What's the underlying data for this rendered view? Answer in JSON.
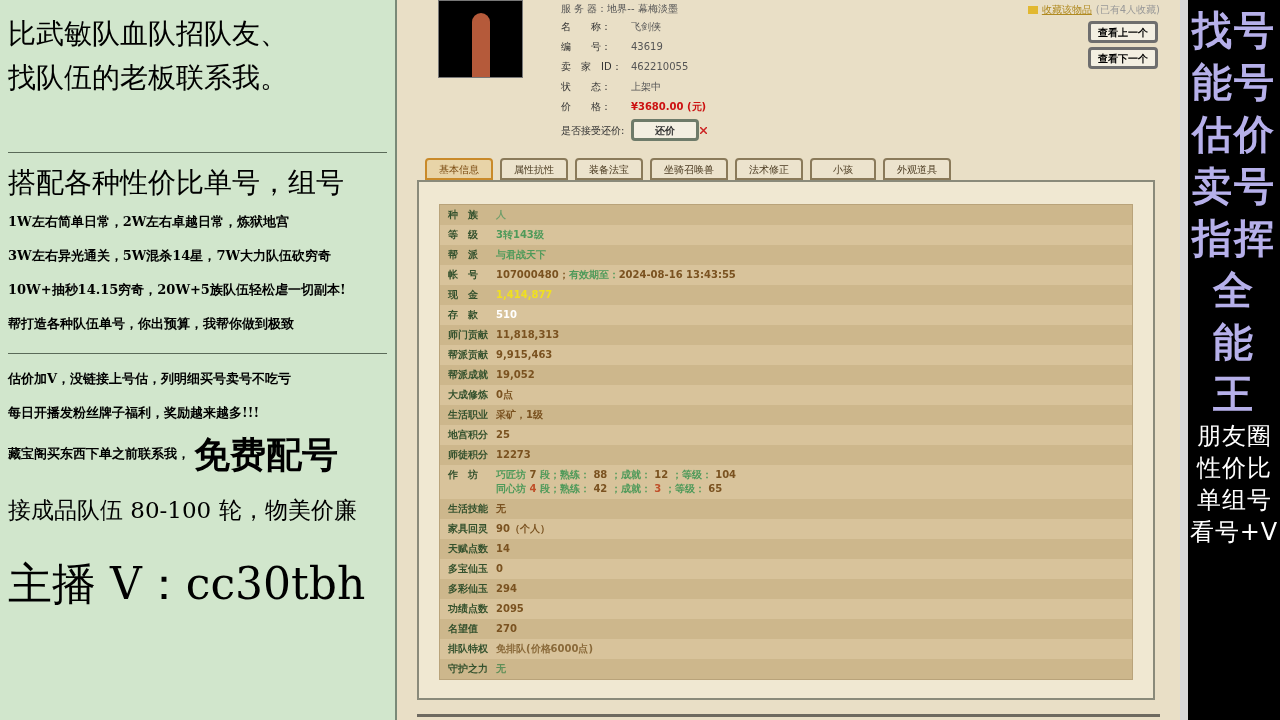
{
  "promo_panel": {
    "sections": [
      {
        "lines": [
          {
            "text": "比武敏队血队招队友、",
            "kind": "l"
          },
          {
            "text": "找队伍的老板联系我。",
            "kind": "l"
          }
        ]
      },
      {
        "lines": [
          {
            "text": "搭配各种性价比单号，组号",
            "kind": "l"
          },
          {
            "text": "1W左右简单日常，2W左右卓越日常，炼狱地宫",
            "kind": "s"
          },
          {
            "text": "3W左右异光通关，5W混杀14星，7W大力队伍砍穷奇",
            "kind": "s"
          },
          {
            "text": "10W+抽秒14.15穷奇，20W+5族队伍轻松虐一切副本!",
            "kind": "s"
          },
          {
            "text": "帮打造各种队伍单号，你出预算，我帮你做到极致",
            "kind": "s"
          }
        ]
      },
      {
        "lines": [
          {
            "text": "估价加V，没链接上号估，列明细买号卖号不吃亏",
            "kind": "s"
          },
          {
            "text": "每日开播发粉丝牌子福利，奖励越来越多!!!",
            "kind": "s"
          },
          {
            "text": "藏宝阁买东西下单之前联系我，",
            "kind": "s",
            "big": "免费配号"
          },
          {
            "text": "接成品队伍 80-100 轮，物美价廉",
            "kind": "m"
          },
          {
            "text": "主播 V：cc30tbh",
            "kind": "xl"
          }
        ]
      }
    ]
  },
  "listing": {
    "server": "服 务 器：地界-- 幕梅淡墨",
    "favorite": "收藏该物品",
    "favorite_count": "(已有4人收藏)",
    "fields": [
      {
        "label": "名　　称：",
        "value": "飞剑侠",
        "kind": "plain"
      },
      {
        "label": "编　　号：",
        "value": "43619",
        "kind": "plain"
      },
      {
        "label": "卖　家　ID：",
        "value": "462210055",
        "kind": "plain"
      },
      {
        "label": "状　　态：",
        "value": "上架中",
        "kind": "plain"
      },
      {
        "label": "价　　格：",
        "value": "¥3680.00 (元)",
        "kind": "price"
      }
    ],
    "counter_offer_label": "是否接受还价:",
    "counter_offer_button": "还价",
    "nav_buttons": [
      "查看上一个",
      "查看下一个"
    ]
  },
  "tabs": [
    {
      "label": "基本信息",
      "selected": true
    },
    {
      "label": "属性抗性",
      "selected": false
    },
    {
      "label": "装备法宝",
      "selected": false
    },
    {
      "label": "坐骑召唤兽",
      "selected": false
    },
    {
      "label": "法术修正",
      "selected": false
    },
    {
      "label": "小孩",
      "selected": false
    },
    {
      "label": "外观道具",
      "selected": false
    }
  ],
  "info_rows": [
    {
      "label": "种　族",
      "lines": [
        [
          {
            "text": "人",
            "color": "#6f9e6a"
          }
        ]
      ]
    },
    {
      "label": "等　级",
      "lines": [
        [
          {
            "text": "3转143级",
            "color": "#4f9a5a"
          }
        ]
      ]
    },
    {
      "label": "帮　派",
      "lines": [
        [
          {
            "text": "与君战天下",
            "color": "#4f9a5a"
          }
        ]
      ]
    },
    {
      "label": "帐　号",
      "lines": [
        [
          {
            "text": "107000480；",
            "color": "#7a5220"
          },
          {
            "text": "有效期至：",
            "color": "#4f9a5a"
          },
          {
            "text": "2024-08-16 13:43:55",
            "color": "#7a5220"
          }
        ]
      ]
    },
    {
      "label": "现　金",
      "lines": [
        [
          {
            "text": "1,414,877",
            "color": "#f0e020"
          }
        ]
      ]
    },
    {
      "label": "存　款",
      "lines": [
        [
          {
            "text": "510",
            "color": "#ffffff"
          }
        ]
      ]
    },
    {
      "label": "师门贡献",
      "lines": [
        [
          {
            "text": "11,818,313",
            "color": "#7a5220"
          }
        ]
      ]
    },
    {
      "label": "帮派贡献",
      "lines": [
        [
          {
            "text": "9,915,463",
            "color": "#7a5220"
          }
        ]
      ]
    },
    {
      "label": "帮派成就",
      "lines": [
        [
          {
            "text": "19,052",
            "color": "#7a5220"
          }
        ]
      ]
    },
    {
      "label": "大成修炼",
      "lines": [
        [
          {
            "text": "0点",
            "color": "#7a5220"
          }
        ]
      ]
    },
    {
      "label": "生活职业",
      "lines": [
        [
          {
            "text": "采矿，1级",
            "color": "#7a5220"
          }
        ]
      ]
    },
    {
      "label": "地宫积分",
      "lines": [
        [
          {
            "text": "25",
            "color": "#7a5220"
          }
        ]
      ]
    },
    {
      "label": "师徒积分",
      "lines": [
        [
          {
            "text": "12273",
            "color": "#7a5220"
          }
        ]
      ]
    },
    {
      "label": "作　坊",
      "lines": [
        [
          {
            "text": "巧匠坊",
            "color": "#4f9a5a"
          },
          {
            "text": " 7 ",
            "color": "#7a5220"
          },
          {
            "text": "段；熟练：",
            "color": "#4f9a5a"
          },
          {
            "text": " 88 ",
            "color": "#7a5220"
          },
          {
            "text": "；成就：",
            "color": "#4f9a5a"
          },
          {
            "text": " 12 ",
            "color": "#7a5220"
          },
          {
            "text": "；等级：",
            "color": "#4f9a5a"
          },
          {
            "text": " 104",
            "color": "#7a5220"
          }
        ],
        [
          {
            "text": "同心坊",
            "color": "#4f9a5a"
          },
          {
            "text": " 4 ",
            "color": "#c0502a"
          },
          {
            "text": "段；熟练：",
            "color": "#4f9a5a"
          },
          {
            "text": " 42 ",
            "color": "#7a5220"
          },
          {
            "text": "；成就：",
            "color": "#4f9a5a"
          },
          {
            "text": " 3 ",
            "color": "#c0502a"
          },
          {
            "text": "；等级：",
            "color": "#4f9a5a"
          },
          {
            "text": " 65",
            "color": "#7a5220"
          }
        ]
      ]
    },
    {
      "label": "生活技能",
      "lines": [
        [
          {
            "text": "无",
            "color": "#7a5220"
          }
        ]
      ]
    },
    {
      "label": "家具回灵",
      "lines": [
        [
          {
            "text": "90（个人）",
            "color": "#7a5220"
          }
        ]
      ]
    },
    {
      "label": "天赋点数",
      "lines": [
        [
          {
            "text": "14",
            "color": "#7a5220"
          }
        ]
      ]
    },
    {
      "label": "多宝仙玉",
      "lines": [
        [
          {
            "text": "0",
            "color": "#7a5220"
          }
        ]
      ]
    },
    {
      "label": "多彩仙玉",
      "lines": [
        [
          {
            "text": "294",
            "color": "#7a5220"
          }
        ]
      ]
    },
    {
      "label": "功绩点数",
      "lines": [
        [
          {
            "text": "2095",
            "color": "#7a5220"
          }
        ]
      ]
    },
    {
      "label": "名望值",
      "lines": [
        [
          {
            "text": "270",
            "color": "#7a5220"
          }
        ]
      ]
    },
    {
      "label": "排队特权",
      "lines": [
        [
          {
            "text": "免排队(价格6000点)",
            "color": "#8a6a3a"
          }
        ]
      ]
    },
    {
      "label": "守护之力",
      "lines": [
        [
          {
            "text": "无",
            "color": "#5f8f58"
          }
        ]
      ]
    }
  ],
  "side_banner": {
    "big_rows": [
      "找号",
      "能号",
      "估价",
      "卖号",
      "指挥",
      "全",
      "能",
      "王"
    ],
    "small_rows": [
      "朋友圈",
      "性价比",
      "单组号",
      "看号+V"
    ]
  }
}
